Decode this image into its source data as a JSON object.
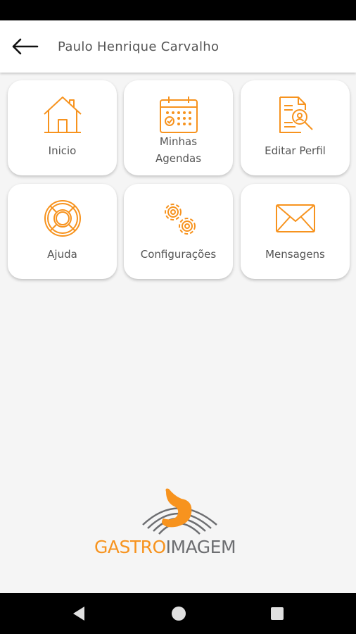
{
  "header": {
    "title": "Paulo Henrique Carvalho",
    "back_icon": "arrow-left-icon"
  },
  "menu": {
    "items": [
      {
        "label": "Inicio",
        "icon": "home-icon"
      },
      {
        "label": "Minhas\nAgendas",
        "icon": "calendar-icon"
      },
      {
        "label": "Editar Perfil",
        "icon": "profile-document-icon"
      },
      {
        "label": "Ajuda",
        "icon": "lifebuoy-icon"
      },
      {
        "label": "Configurações",
        "icon": "gears-icon"
      },
      {
        "label": "Mensagens",
        "icon": "envelope-icon"
      }
    ]
  },
  "logo": {
    "word_orange": "GASTRO",
    "word_grey": "IMAGEM"
  },
  "navigation": {
    "back": "back-triangle-icon",
    "home": "home-circle-icon",
    "recents": "recents-square-icon"
  },
  "colors": {
    "accent": "#f7931e",
    "text": "#555555",
    "background": "#f5f5f5",
    "logo_grey": "#6d6e71"
  }
}
